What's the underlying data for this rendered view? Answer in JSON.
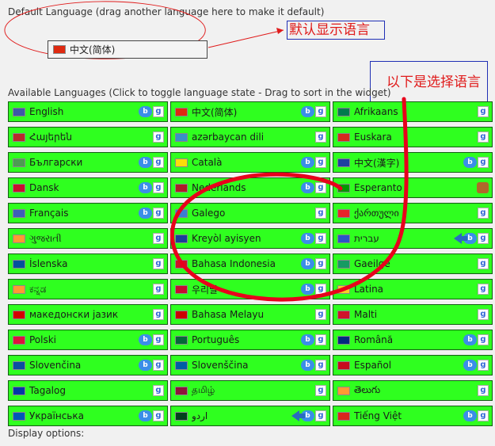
{
  "default_section": {
    "label": "Default Language (drag another language here to make it default)",
    "default_language": {
      "name": "中文(简体)",
      "flag": "cn"
    }
  },
  "annotations": {
    "default_note": "默认显示语言",
    "available_note": "以下是选择语言"
  },
  "available_section": {
    "label": "Available Languages (Click to toggle language state - Drag to sort in the widget)"
  },
  "display_options": {
    "label": "Display options:"
  },
  "flag_colors": {
    "us": "#3c5aa6",
    "cn": "#de2910",
    "za": "#007a4d",
    "am": "#b82b2b",
    "az": "#3a8fc8",
    "eus": "#d52b1e",
    "bg": "#4d9c52",
    "cat": "#fcdd09",
    "tw": "#1f3ea0",
    "dk": "#c8102e",
    "nl": "#ae1c28",
    "eo": "#009900",
    "fr": "#3d5fb8",
    "gl": "#3b7fd4",
    "ge": "#e8242a",
    "in": "#ff9933",
    "ht": "#1b3f9a",
    "il": "#2c54c7",
    "is": "#02529c",
    "id": "#ce1126",
    "ie": "#169b62",
    "kr": "#c60c30",
    "va": "#f4d125",
    "mk": "#d20000",
    "my": "#cc0001",
    "mt": "#cf142b",
    "pl": "#dc143c",
    "pt": "#046a38",
    "ro": "#002b7f",
    "sk": "#0b4ea2",
    "si": "#005da4",
    "es": "#c60b1e",
    "ph": "#0038a8",
    "lk": "#8d153a",
    "ua": "#0057b7",
    "pk": "#01411c",
    "vn": "#da251d"
  },
  "languages": [
    {
      "name": "English",
      "flag": "us",
      "badges": [
        "bing",
        "google"
      ]
    },
    {
      "name": "中文(简体)",
      "flag": "cn",
      "badges": [
        "bing",
        "google"
      ]
    },
    {
      "name": "Afrikaans",
      "flag": "za",
      "badges": [
        "google"
      ]
    },
    {
      "name": "Հայերեն",
      "flag": "am",
      "badges": [
        "google"
      ]
    },
    {
      "name": "azərbaycan dili",
      "flag": "az",
      "badges": [
        "google"
      ]
    },
    {
      "name": "Euskara",
      "flag": "eus",
      "badges": [
        "google"
      ]
    },
    {
      "name": "Български",
      "flag": "bg",
      "badges": [
        "bing",
        "google"
      ]
    },
    {
      "name": "Català",
      "flag": "cat",
      "badges": [
        "bing",
        "google"
      ]
    },
    {
      "name": "中文(漢字)",
      "flag": "tw",
      "badges": [
        "bing",
        "google"
      ]
    },
    {
      "name": "Dansk",
      "flag": "dk",
      "badges": [
        "bing",
        "google"
      ]
    },
    {
      "name": "Nederlands",
      "flag": "nl",
      "badges": [
        "bing",
        "google"
      ]
    },
    {
      "name": "Esperanto",
      "flag": "eo",
      "badges": [
        "fox"
      ]
    },
    {
      "name": "Français",
      "flag": "fr",
      "badges": [
        "bing",
        "google"
      ]
    },
    {
      "name": "Galego",
      "flag": "gl",
      "badges": [
        "google"
      ]
    },
    {
      "name": "ქართული",
      "flag": "ge",
      "badges": [
        "google"
      ]
    },
    {
      "name": "ગુજરાતી",
      "flag": "in",
      "badges": [
        "google"
      ]
    },
    {
      "name": "Kreyòl ayisyen",
      "flag": "ht",
      "badges": [
        "bing",
        "google"
      ]
    },
    {
      "name": "עברית",
      "flag": "il",
      "badges": [
        "arrow",
        "bing",
        "google"
      ]
    },
    {
      "name": "Íslenska",
      "flag": "is",
      "badges": [
        "google"
      ]
    },
    {
      "name": "Bahasa Indonesia",
      "flag": "id",
      "badges": [
        "bing",
        "google"
      ]
    },
    {
      "name": "Gaeilge",
      "flag": "ie",
      "badges": [
        "google"
      ]
    },
    {
      "name": "ಕನ್ನಡ",
      "flag": "in",
      "badges": [
        "google"
      ]
    },
    {
      "name": "우리말",
      "flag": "kr",
      "badges": [
        "bing",
        "google"
      ]
    },
    {
      "name": "Latina",
      "flag": "va",
      "badges": [
        "google"
      ]
    },
    {
      "name": "македонски јазик",
      "flag": "mk",
      "badges": [
        "google"
      ]
    },
    {
      "name": "Bahasa Melayu",
      "flag": "my",
      "badges": [
        "google"
      ]
    },
    {
      "name": "Malti",
      "flag": "mt",
      "badges": [
        "google"
      ]
    },
    {
      "name": "Polski",
      "flag": "pl",
      "badges": [
        "bing",
        "google"
      ]
    },
    {
      "name": "Português",
      "flag": "pt",
      "badges": [
        "bing",
        "google"
      ]
    },
    {
      "name": "Română",
      "flag": "ro",
      "badges": [
        "bing",
        "google"
      ]
    },
    {
      "name": "Slovenčina",
      "flag": "sk",
      "badges": [
        "bing",
        "google"
      ]
    },
    {
      "name": "Slovenščina",
      "flag": "si",
      "badges": [
        "bing",
        "google"
      ]
    },
    {
      "name": "Español",
      "flag": "es",
      "badges": [
        "bing",
        "google"
      ]
    },
    {
      "name": "Tagalog",
      "flag": "ph",
      "badges": [
        "google"
      ]
    },
    {
      "name": "தமிழ்",
      "flag": "lk",
      "badges": [
        "google"
      ]
    },
    {
      "name": "తెలుగు",
      "flag": "in",
      "badges": [
        "google"
      ]
    },
    {
      "name": "Українська",
      "flag": "ua",
      "badges": [
        "bing",
        "google"
      ]
    },
    {
      "name": "اردو",
      "flag": "pk",
      "badges": [
        "arrow",
        "bing",
        "google"
      ]
    },
    {
      "name": "Tiếng Việt",
      "flag": "vn",
      "badges": [
        "bing",
        "google"
      ]
    }
  ]
}
